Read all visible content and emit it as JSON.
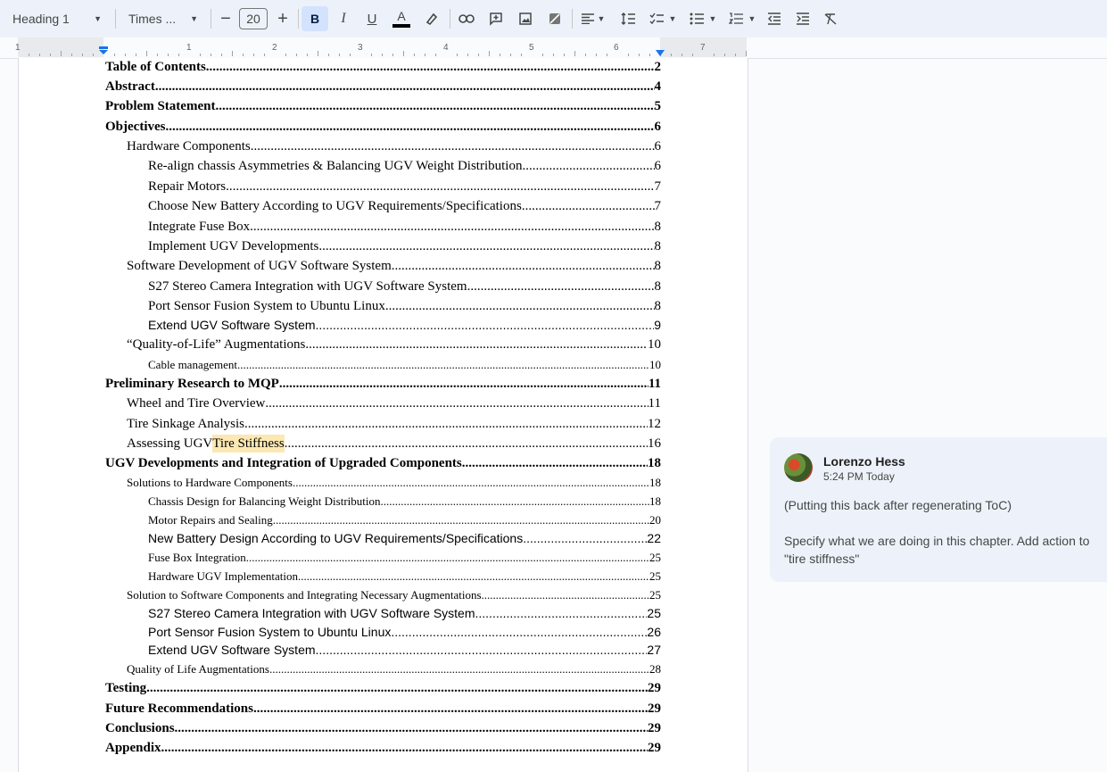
{
  "toolbar": {
    "style": "Heading 1",
    "font": "Times ...",
    "font_size": "20",
    "icons": [
      "chevron-down-icon",
      "minus-icon",
      "plus-icon",
      "bold-icon",
      "italic-icon",
      "underline-icon",
      "text-color-icon",
      "highlight-icon",
      "link-icon",
      "add-comment-icon",
      "image-icon",
      "eraser-icon",
      "align-left-icon",
      "line-spacing-icon",
      "checklist-icon",
      "bullet-list-icon",
      "numbered-list-icon",
      "decrease-indent-icon",
      "increase-indent-icon",
      "clear-formatting-icon"
    ],
    "accent": "#0b57d0"
  },
  "ruler": {
    "labels": [
      "1",
      "1",
      "2",
      "3",
      "4",
      "5",
      "6",
      "7"
    ]
  },
  "toc": [
    {
      "title": "Table of Contents",
      "page": "2",
      "level": 0,
      "bold": true,
      "font": "serif",
      "size": 15
    },
    {
      "title": "Abstract",
      "page": "4",
      "level": 0,
      "bold": true,
      "font": "serif",
      "size": 15
    },
    {
      "title": "Problem Statement",
      "page": "5",
      "level": 0,
      "bold": true,
      "font": "serif",
      "size": 15
    },
    {
      "title": "Objectives",
      "page": "6",
      "level": 0,
      "bold": true,
      "font": "serif",
      "size": 15
    },
    {
      "title": "Hardware Components",
      "page": "6",
      "level": 1,
      "bold": false,
      "font": "serif",
      "size": 15
    },
    {
      "title": "Re-align chassis Asymmetries & Balancing UGV Weight Distribution",
      "page": "6",
      "level": 2,
      "bold": false,
      "font": "serif",
      "size": 15
    },
    {
      "title": "Repair Motors",
      "page": "7",
      "level": 2,
      "bold": false,
      "font": "serif",
      "size": 15
    },
    {
      "title": "Choose New Battery According to UGV Requirements/Specifications",
      "page": "7",
      "level": 2,
      "bold": false,
      "font": "serif",
      "size": 15
    },
    {
      "title": "Integrate Fuse Box",
      "page": "8",
      "level": 2,
      "bold": false,
      "font": "serif",
      "size": 15
    },
    {
      "title": "Implement UGV Developments",
      "page": "8",
      "level": 2,
      "bold": false,
      "font": "serif",
      "size": 15
    },
    {
      "title": "Software Development of UGV Software System",
      "page": "8",
      "level": 1,
      "bold": false,
      "font": "serif",
      "size": 15
    },
    {
      "title": "S27 Stereo Camera Integration with UGV Software System",
      "page": "8",
      "level": 2,
      "bold": false,
      "font": "serif",
      "size": 15
    },
    {
      "title": "Port Sensor Fusion System to Ubuntu Linux",
      "page": "8",
      "level": 2,
      "bold": false,
      "font": "serif",
      "size": 15
    },
    {
      "title": "Extend UGV Software System",
      "page": "9",
      "level": 2,
      "bold": false,
      "font": "sans",
      "size": 14
    },
    {
      "title": "“Quality-of-Life” Augmentations",
      "page": "10",
      "level": 1,
      "bold": false,
      "font": "serif",
      "size": 15
    },
    {
      "title": "Cable management",
      "page": "10",
      "level": 2,
      "bold": false,
      "font": "serif",
      "size": 13
    },
    {
      "title": "Preliminary Research to MQP",
      "page": "11",
      "level": 0,
      "bold": true,
      "font": "serif",
      "size": 15
    },
    {
      "title": "Wheel and Tire Overview",
      "page": "11",
      "level": 1,
      "bold": false,
      "font": "serif",
      "size": 15
    },
    {
      "title": "Tire Sinkage Analysis",
      "page": "12",
      "level": 1,
      "bold": false,
      "font": "serif",
      "size": 15
    },
    {
      "title": "Assessing UGV ",
      "highlight": "Tire Stiffness",
      "page": "16",
      "level": 1,
      "bold": false,
      "font": "serif",
      "size": 15
    },
    {
      "title": "UGV Developments and Integration of Upgraded Components",
      "page": "18",
      "level": 0,
      "bold": true,
      "font": "serif",
      "size": 15
    },
    {
      "title": "Solutions to Hardware Components",
      "page": "18",
      "level": 1,
      "bold": false,
      "font": "serif",
      "size": 13
    },
    {
      "title": "Chassis Design for Balancing Weight Distribution",
      "page": "18",
      "level": 2,
      "bold": false,
      "font": "serif",
      "size": 13
    },
    {
      "title": "Motor Repairs and Sealing",
      "page": "20",
      "level": 2,
      "bold": false,
      "font": "serif",
      "size": 13
    },
    {
      "title": "New Battery Design According to UGV Requirements/Specifications",
      "page": "22",
      "level": 2,
      "bold": false,
      "font": "sans",
      "size": 14
    },
    {
      "title": "Fuse Box Integration",
      "page": "25",
      "level": 2,
      "bold": false,
      "font": "serif",
      "size": 13
    },
    {
      "title": "Hardware UGV Implementation",
      "page": "25",
      "level": 2,
      "bold": false,
      "font": "serif",
      "size": 13
    },
    {
      "title": "Solution to Software Components and Integrating Necessary Augmentations",
      "page": "25",
      "level": 1,
      "bold": false,
      "font": "serif",
      "size": 13
    },
    {
      "title": "S27 Stereo Camera Integration with UGV Software System",
      "page": "25",
      "level": 2,
      "bold": false,
      "font": "sans",
      "size": 14
    },
    {
      "title": "Port Sensor Fusion System to Ubuntu Linux",
      "page": "26",
      "level": 2,
      "bold": false,
      "font": "sans",
      "size": 14
    },
    {
      "title": "Extend UGV Software System",
      "page": "27",
      "level": 2,
      "bold": false,
      "font": "sans",
      "size": 14
    },
    {
      "title": "Quality of Life Augmentations",
      "page": "28",
      "level": 1,
      "bold": false,
      "font": "serif",
      "size": 13
    },
    {
      "title": "Testing",
      "page": "29",
      "level": 0,
      "bold": true,
      "font": "serif",
      "size": 15
    },
    {
      "title": "Future Recommendations",
      "page": "29",
      "level": 0,
      "bold": true,
      "font": "serif",
      "size": 15
    },
    {
      "title": "Conclusions",
      "page": "29",
      "level": 0,
      "bold": true,
      "font": "serif",
      "size": 15
    },
    {
      "title": "Appendix",
      "page": "29",
      "level": 0,
      "bold": true,
      "font": "serif",
      "size": 15
    }
  ],
  "comment": {
    "author": "Lorenzo Hess",
    "time": "5:24 PM Today",
    "line1": "(Putting this back after regenerating ToC)",
    "line2": "Specify what we are doing in this chapter. Add action to \"tire stiffness\""
  }
}
